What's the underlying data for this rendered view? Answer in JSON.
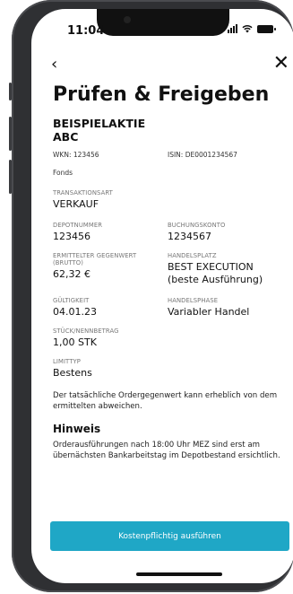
{
  "status_bar": {
    "time": "11:04"
  },
  "header": {
    "back_icon": "‹",
    "close_icon": "✕"
  },
  "page": {
    "title": "Prüfen & Freigeben",
    "instrument_name_line1": "BEISPIELAKTIE",
    "instrument_name_line2": "ABC",
    "wkn": "WKN: 123456",
    "isin": "ISIN: DE0001234567",
    "type": "Fonds"
  },
  "fields": {
    "transaktionsart": {
      "label": "TRANSAKTIONSART",
      "value": "VERKAUF"
    },
    "depotnummer": {
      "label": "DEPOTNUMMER",
      "value": "123456"
    },
    "buchungskonto": {
      "label": "BUCHUNGSKONTO",
      "value": "1234567"
    },
    "gegenwert": {
      "label": "ERMITTELTER GEGENWERT (BRUTTO)",
      "value": "62,32 €"
    },
    "handelsplatz": {
      "label": "HANDELSPLATZ",
      "value": "BEST EXECUTION (beste Ausführung)"
    },
    "gueltigkeit": {
      "label": "GÜLTIGKEIT",
      "value": "04.01.23"
    },
    "handelsphase": {
      "label": "HANDELSPHASE",
      "value": "Variabler Handel"
    },
    "stueck": {
      "label": "STÜCK/NENNBETRAG",
      "value": "1,00 STK"
    },
    "limittyp": {
      "label": "LIMITTYP",
      "value": "Bestens"
    }
  },
  "notes": {
    "disclaimer": "Der tatsächliche Ordergegenwert kann erheblich von dem ermittelten abweichen.",
    "hint_title": "Hinweis",
    "hint_text": "Orderausführungen nach 18:00 Uhr MEZ sind erst am übernächsten Bankarbeitstag im Depotbestand ersichtlich."
  },
  "cta": {
    "label": "Kostenpflichtig ausführen",
    "color": "#1fa7c6"
  },
  "icons": [
    "back-chevron-icon",
    "close-icon",
    "signal-icon",
    "wifi-icon",
    "battery-icon"
  ]
}
